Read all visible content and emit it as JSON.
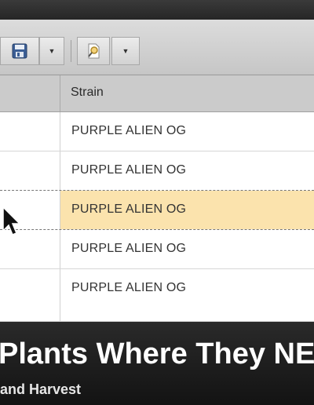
{
  "toolbar": {
    "buttons": [
      {
        "icon": "save-icon"
      },
      {
        "icon": "dropdown-caret-icon"
      },
      {
        "icon": "search-document-icon"
      },
      {
        "icon": "dropdown-caret-icon"
      }
    ]
  },
  "grid": {
    "columns": [
      "",
      "Strain"
    ],
    "rows": [
      {
        "strain": "PURPLE ALIEN OG",
        "selected": false
      },
      {
        "strain": "PURPLE ALIEN OG",
        "selected": false
      },
      {
        "strain": "PURPLE ALIEN OG",
        "selected": true
      },
      {
        "strain": "PURPLE ALIEN OG",
        "selected": false
      },
      {
        "strain": "PURPLE ALIEN OG",
        "selected": false
      }
    ]
  },
  "banner": {
    "title": "Plants Where They NE",
    "subtitle": "and Harvest"
  },
  "colors": {
    "selected_row": "#fbe3ad",
    "header": "#cbcbcb",
    "banner": "#1a1a1a"
  }
}
